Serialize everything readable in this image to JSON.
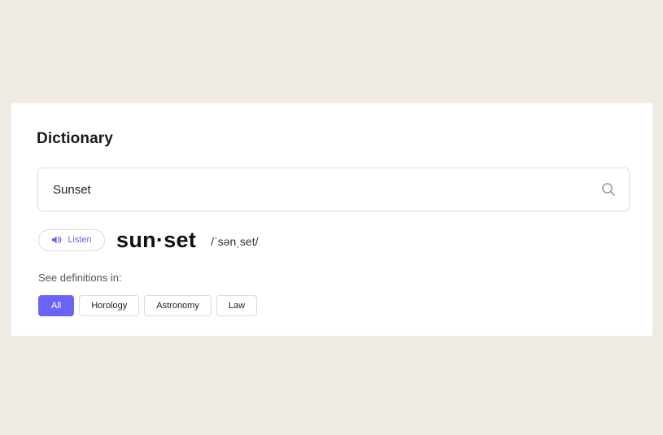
{
  "dictionary": {
    "title": "Dictionary",
    "search": {
      "value": "Sunset",
      "icon": "search-icon"
    },
    "listen": {
      "label": "Listen",
      "icon": "speaker-icon"
    },
    "entry": {
      "headword": "sun·set",
      "phonetic": "/ˈsənˌset/"
    },
    "definitions_label": "See definitions in:",
    "categories": [
      {
        "label": "All",
        "active": true
      },
      {
        "label": "Horology",
        "active": false
      },
      {
        "label": "Astronomy",
        "active": false
      },
      {
        "label": "Law",
        "active": false
      }
    ]
  },
  "colors": {
    "background": "#efebe2",
    "accent": "#6b63f5",
    "card": "#ffffff"
  }
}
